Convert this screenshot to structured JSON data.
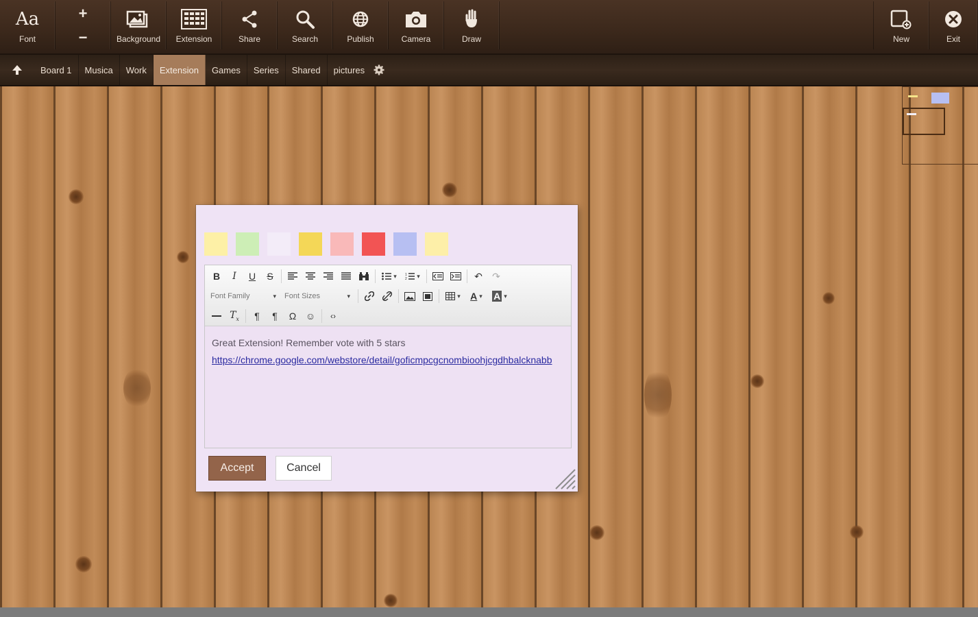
{
  "toolbar": {
    "font": {
      "glyph": "Aa",
      "label": "Font"
    },
    "zoom": {
      "plus": "+",
      "minus": "−"
    },
    "background": {
      "label": "Background"
    },
    "extension": {
      "label": "Extension"
    },
    "share": {
      "label": "Share"
    },
    "search": {
      "label": "Search"
    },
    "publish": {
      "label": "Publish"
    },
    "camera": {
      "label": "Camera"
    },
    "draw": {
      "label": "Draw"
    },
    "new": {
      "label": "New"
    },
    "exit": {
      "label": "Exit"
    }
  },
  "tabs": [
    {
      "label": "Board 1"
    },
    {
      "label": "Musica"
    },
    {
      "label": "Work"
    },
    {
      "label": "Extension",
      "active": true
    },
    {
      "label": "Games"
    },
    {
      "label": "Series"
    },
    {
      "label": "Shared"
    },
    {
      "label": "pictures"
    }
  ],
  "dialog": {
    "swatches": [
      "#fdf0a6",
      "#cdeeb6",
      "#f3ecf8",
      "#f4d757",
      "#f9b9b9",
      "#f25454",
      "#b7bff2",
      "#fdefa8"
    ],
    "editor": {
      "font_family_placeholder": "Font Family",
      "font_size_placeholder": "Font Sizes",
      "text": "Great Extension! Remember vote with 5 stars",
      "link": "https://chrome.google.com/webstore/detail/goficmpcgcnombioohjcgdhbalcknabb"
    },
    "accept_label": "Accept",
    "cancel_label": "Cancel"
  },
  "colors": {
    "toolbar_bg": "#3b281b",
    "active_tab": "#a67c5a",
    "accept_button": "#93644a",
    "dialog_bg": "#efe3f5"
  }
}
